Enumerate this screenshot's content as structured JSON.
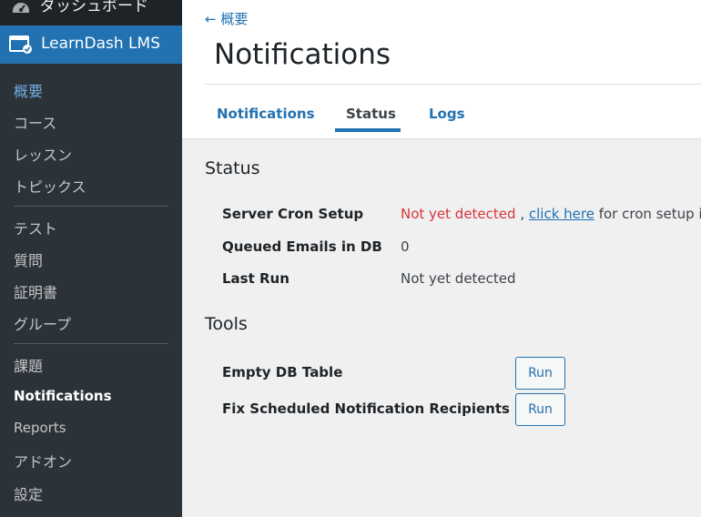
{
  "sidebar": {
    "dashboard_label": "ダッシュボード",
    "active_menu_label": "LearnDash LMS",
    "items": [
      {
        "label": "概要"
      },
      {
        "label": "コース"
      },
      {
        "label": "レッスン"
      },
      {
        "label": "トピックス"
      },
      {
        "label": "テスト"
      },
      {
        "label": "質問"
      },
      {
        "label": "証明書"
      },
      {
        "label": "グループ"
      },
      {
        "label": "課題"
      },
      {
        "label": "Notifications"
      },
      {
        "label": "Reports"
      },
      {
        "label": "アドオン"
      },
      {
        "label": "設定"
      }
    ]
  },
  "header": {
    "back_link": "← 概要",
    "title": "Notifications"
  },
  "tabs": [
    {
      "label": "Notifications"
    },
    {
      "label": "Status"
    },
    {
      "label": "Logs"
    }
  ],
  "status": {
    "title": "Status",
    "server_cron_label": "Server Cron Setup",
    "server_cron_value": "Not yet detected",
    "server_cron_sep": " , ",
    "server_cron_link": "click here",
    "server_cron_suffix": " for cron setup ins",
    "queued_label": "Queued Emails in DB",
    "queued_value": "0",
    "last_run_label": "Last Run",
    "last_run_value": "Not yet detected"
  },
  "tools": {
    "title": "Tools",
    "empty_label": "Empty DB Table",
    "fix_label": "Fix Scheduled Notification Recipients",
    "run_label": "Run"
  },
  "colors": {
    "sidebar_bg": "#1d2327",
    "accent": "#2271b1",
    "error": "#d63638"
  }
}
